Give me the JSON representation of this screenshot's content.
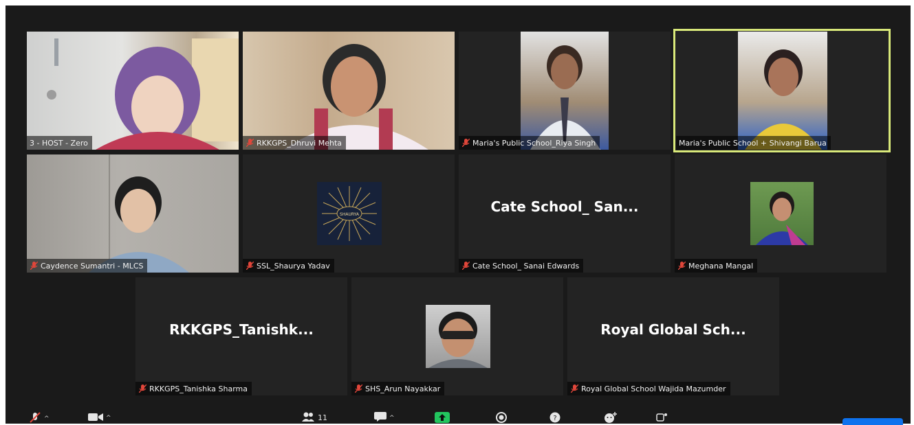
{
  "participants": [
    {
      "label": "3 - HOST - Zero",
      "muted": false
    },
    {
      "label": "RKKGPS_Dhruvi Mehta",
      "muted": true
    },
    {
      "label": "Maria's Public School_Riya Singh",
      "muted": true
    },
    {
      "label": "Maria's Public School + Shivangi Barua",
      "muted": false,
      "active_speaker": true
    },
    {
      "label": "Caydence Sumantri - MLCS",
      "muted": true
    },
    {
      "label": "SSL_Shaurya Yadav",
      "muted": true,
      "avatar_text": "SHAURYA"
    },
    {
      "label": "Cate School_ Sanai Edwards",
      "muted": true,
      "display_name": "Cate School_ San..."
    },
    {
      "label": "Meghana Mangal",
      "muted": true
    },
    {
      "label": "RKKGPS_Tanishka Sharma",
      "muted": true,
      "display_name": "RKKGPS_Tanishk..."
    },
    {
      "label": "SHS_Arun Nayakkar",
      "muted": true
    },
    {
      "label": "Royal Global School Wajida Mazumder",
      "muted": true,
      "display_name": "Royal Global Sch..."
    }
  ],
  "toolbar": {
    "participant_count": "11",
    "icons": [
      "microphone-muted-icon",
      "video-camera-icon",
      "participants-icon",
      "chat-icon",
      "share-screen-icon",
      "record-icon",
      "help-icon",
      "reactions-icon",
      "apps-icon"
    ]
  },
  "colors": {
    "background": "#1a1a1a",
    "tile": "#232323",
    "active_speaker_border": "#d9e97a",
    "mute_icon": "#e0463a",
    "share_button": "#22c55e",
    "leave_button": "#0e72ed"
  }
}
